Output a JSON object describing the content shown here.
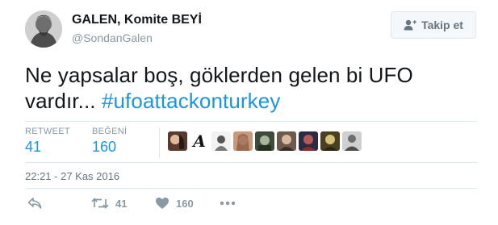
{
  "tweet": {
    "user": {
      "name": "GALEN, Komite BEYİ",
      "handle": "@SondanGalen",
      "avatar_icon": "portrait-engraving-avatar"
    },
    "follow_button": {
      "label": "Takip et",
      "icon": "add-user-icon"
    },
    "text_plain": "Ne yapsalar boş, göklerden gelen bi UFO vardır...",
    "text_hashtag": "#ufoattackonturkey",
    "stats": {
      "retweets_label": "RETWEET",
      "retweets_value": "41",
      "likes_label": "BEĞENİ",
      "likes_value": "160"
    },
    "timestamp": "22:21 - 27 Kas 2016",
    "actions": {
      "reply_icon": "reply-icon",
      "retweet_icon": "retweet-icon",
      "retweet_count": "41",
      "like_icon": "heart-icon",
      "like_count": "160",
      "more_icon": "more-dots-icon"
    },
    "liker_avatars_count_shown": 9,
    "colors": {
      "link_blue": "#1b95e0",
      "muted_gray": "#8899a6",
      "text_dark": "#14171a",
      "border": "#e1e8ed"
    }
  }
}
